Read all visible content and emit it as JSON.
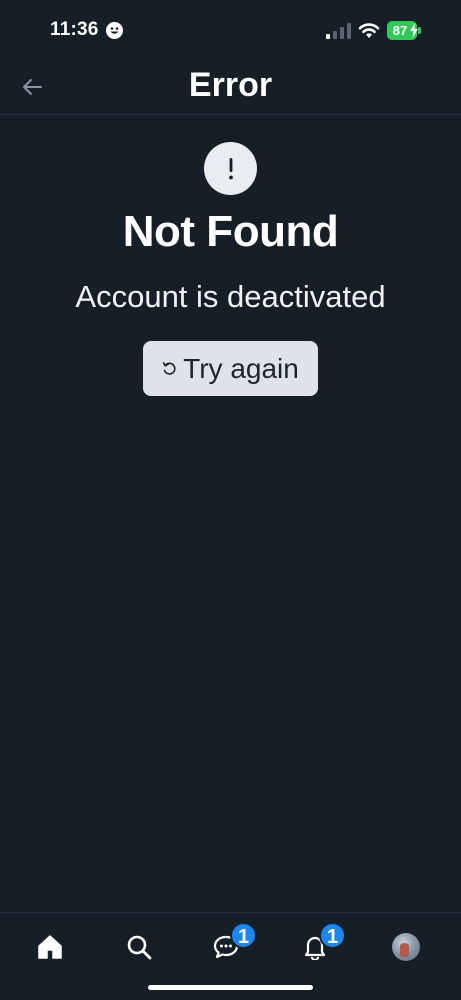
{
  "status_bar": {
    "time": "11:36",
    "battery": "87",
    "icons": [
      "face-icon",
      "signal-icon",
      "wifi-icon",
      "battery-icon"
    ]
  },
  "header": {
    "title": "Error",
    "back_icon": "arrow-left-icon"
  },
  "error": {
    "icon": "exclamation-icon",
    "heading": "Not Found",
    "message": "Account is deactivated",
    "retry_label": "Try again",
    "retry_icon": "refresh-icon"
  },
  "bottom_nav": {
    "items": [
      {
        "name": "home",
        "icon": "home-icon"
      },
      {
        "name": "search",
        "icon": "search-icon"
      },
      {
        "name": "chat",
        "icon": "chat-icon",
        "badge": "1"
      },
      {
        "name": "notifications",
        "icon": "bell-icon",
        "badge": "1"
      },
      {
        "name": "profile",
        "icon": "avatar"
      }
    ]
  },
  "colors": {
    "background": "#161e27",
    "badge": "#1d87f0",
    "battery": "#34c759",
    "button": "#dfe3e9"
  }
}
